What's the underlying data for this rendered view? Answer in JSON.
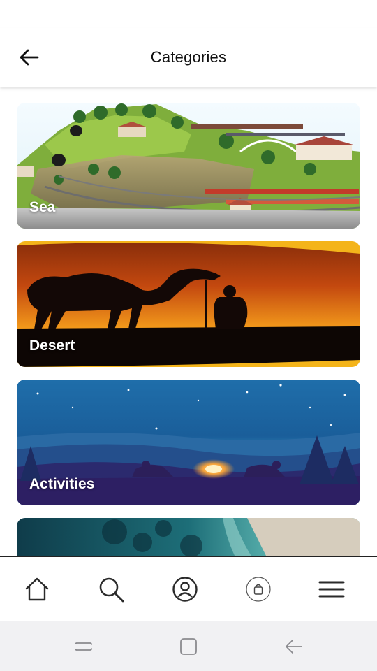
{
  "header": {
    "title": "Categories",
    "back_icon": "arrow-left-icon"
  },
  "categories": [
    {
      "label": "Sea",
      "image": "landscape-railway-model"
    },
    {
      "label": "Desert",
      "image": "camel-silhouette-sunset"
    },
    {
      "label": "Activities",
      "image": "night-campfire"
    },
    {
      "label": "",
      "image": "aerial-beach-coast"
    }
  ],
  "bottom_nav": [
    {
      "icon": "home-icon"
    },
    {
      "icon": "search-icon"
    },
    {
      "icon": "profile-icon"
    },
    {
      "icon": "shopping-bag-icon"
    },
    {
      "icon": "menu-icon"
    }
  ],
  "system_nav": [
    {
      "icon": "recent-apps-icon"
    },
    {
      "icon": "home-square-icon"
    },
    {
      "icon": "back-icon"
    }
  ],
  "colors": {
    "header_bg": "#ffffff",
    "text": "#111111",
    "nav_border": "#222222",
    "system_bar_bg": "#f1f1f3"
  }
}
